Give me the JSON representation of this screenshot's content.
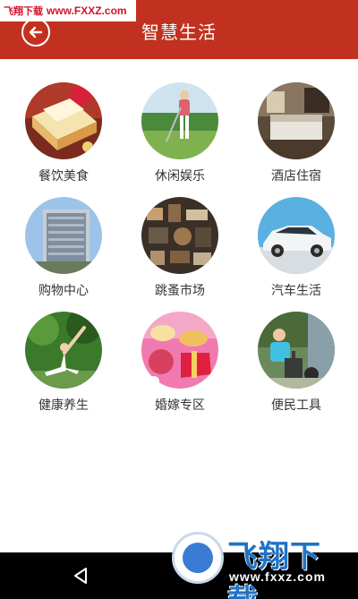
{
  "header": {
    "title": "智慧生活",
    "back_icon": "back-arrow-circle-icon",
    "bg_color": "#c2311f"
  },
  "watermark": {
    "top_cn": "飞翔下载",
    "top_url": "www.FXXZ.com",
    "brand": "飞翔下载",
    "site": "www.fxxz.com"
  },
  "grid": {
    "items": [
      {
        "label": "餐饮美食",
        "icon": "food-cake-photo"
      },
      {
        "label": "休闲娱乐",
        "icon": "golf-photo"
      },
      {
        "label": "酒店住宿",
        "icon": "hotel-room-photo"
      },
      {
        "label": "购物中心",
        "icon": "mall-building-photo"
      },
      {
        "label": "跳蚤市场",
        "icon": "flea-market-photo"
      },
      {
        "label": "汽车生活",
        "icon": "car-photo"
      },
      {
        "label": "健康养生",
        "icon": "yoga-photo"
      },
      {
        "label": "婚嫁专区",
        "icon": "wedding-photo"
      },
      {
        "label": "便民工具",
        "icon": "convenience-tools-photo"
      }
    ]
  },
  "navbar": {
    "back_icon": "nav-back-triangle-icon"
  }
}
